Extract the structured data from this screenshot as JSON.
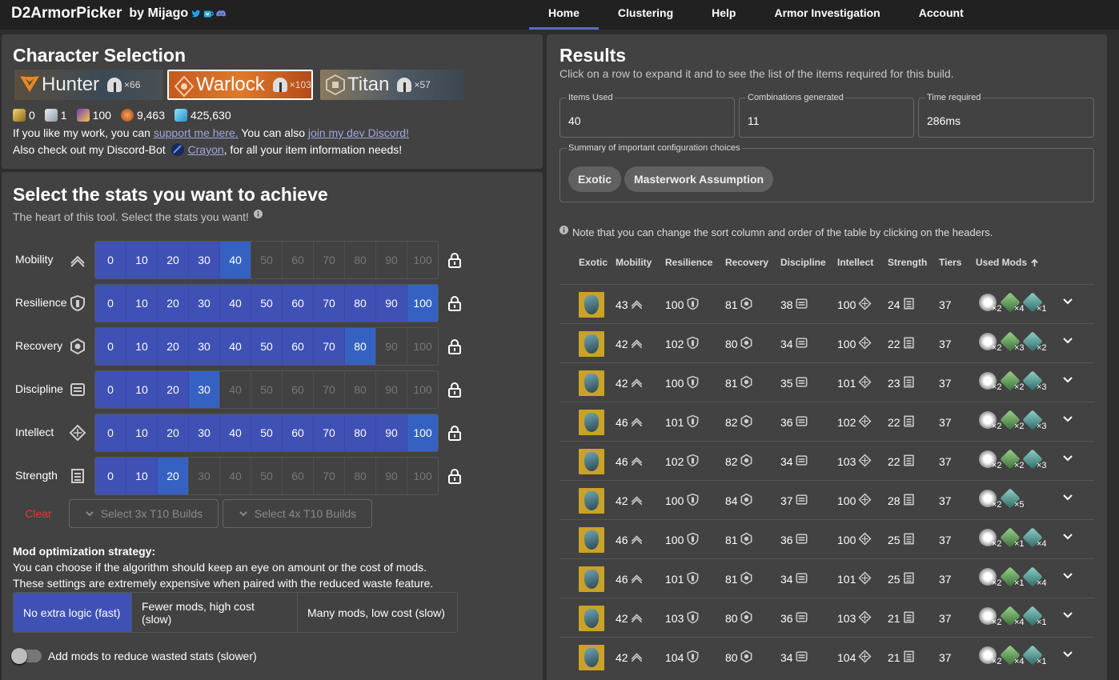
{
  "app": {
    "title": "D2ArmorPicker",
    "by": "by Mijago",
    "social_icons": [
      "twitter-icon",
      "ko-fi-icon",
      "discord-icon"
    ]
  },
  "nav": {
    "items": [
      {
        "label": "Home",
        "active": true
      },
      {
        "label": "Clustering",
        "active": false
      },
      {
        "label": "Help",
        "active": false
      },
      {
        "label": "Armor Investigation",
        "active": false
      },
      {
        "label": "Account",
        "active": false
      }
    ]
  },
  "character": {
    "title": "Character Selection",
    "classes": [
      {
        "name": "Hunter",
        "count": "×66",
        "selected": false
      },
      {
        "name": "Warlock",
        "count": "×103",
        "selected": true
      },
      {
        "name": "Titan",
        "count": "×57",
        "selected": false
      }
    ],
    "currencies": [
      "0",
      "1",
      "100",
      "9,463",
      "425,630"
    ],
    "support_prefix": "If you like my work, you can ",
    "support_link": "support me here.",
    "support_mid": " You can also ",
    "discord_link": "join my dev Discord!",
    "bot_prefix": "Also check out my Discord-Bot ",
    "bot_link": "Crayon",
    "bot_suffix": ", for all your item information needs!"
  },
  "stats": {
    "title": "Select the stats you want to achieve",
    "subtitle": "The heart of this tool. Select the stats you want!",
    "ticks": [
      "0",
      "10",
      "20",
      "30",
      "40",
      "50",
      "60",
      "70",
      "80",
      "90",
      "100"
    ],
    "rows": [
      {
        "name": "Mobility",
        "value": 40
      },
      {
        "name": "Resilience",
        "value": 100
      },
      {
        "name": "Recovery",
        "value": 80
      },
      {
        "name": "Discipline",
        "value": 30
      },
      {
        "name": "Intellect",
        "value": 100
      },
      {
        "name": "Strength",
        "value": 20
      }
    ],
    "clear_label": "Clear",
    "t10_3_label": "Select 3x T10 Builds",
    "t10_4_label": "Select 4x T10 Builds",
    "mod_strategy_title": "Mod optimization strategy:",
    "mod_strategy_line1": "You can choose if the algorithm should keep an eye on amount or the cost of mods.",
    "mod_strategy_line2": "These settings are extremely expensive when paired with the reduced waste feature.",
    "strategy_options": [
      {
        "label": "No extra logic (fast)",
        "active": true
      },
      {
        "label": "Fewer mods, high cost (slow)",
        "active": false
      },
      {
        "label": "Many mods, low cost (slow)",
        "active": false
      }
    ],
    "reduce_waste_label": "Add mods to reduce wasted stats (slower)"
  },
  "results": {
    "title": "Results",
    "subtitle": "Click on a row to expand it and to see the list of the items required for this build.",
    "items_used_label": "Items Used",
    "items_used": "40",
    "combinations_label": "Combinations generated",
    "combinations": "11",
    "time_label": "Time required",
    "time": "286ms",
    "summary_label": "Summary of important configuration choices",
    "chips": [
      "Exotic",
      "Masterwork Assumption"
    ],
    "note": "Note that you can change the sort column and order of the table by clicking on the headers.",
    "headers": [
      "Exotic",
      "Mobility",
      "Resilience",
      "Recovery",
      "Discipline",
      "Intellect",
      "Strength",
      "Tiers",
      "Used Mods"
    ],
    "rows": [
      {
        "mob": "43",
        "res": "100",
        "rec": "81",
        "dis": "38",
        "int": "100",
        "str": "24",
        "tiers": "37",
        "mods": [
          [
            "×2",
            "white"
          ],
          [
            "×4",
            "green"
          ],
          [
            "×1",
            "teal"
          ]
        ]
      },
      {
        "mob": "42",
        "res": "102",
        "rec": "80",
        "dis": "34",
        "int": "100",
        "str": "22",
        "tiers": "37",
        "mods": [
          [
            "×2",
            "white"
          ],
          [
            "×3",
            "green"
          ],
          [
            "×2",
            "teal"
          ]
        ]
      },
      {
        "mob": "42",
        "res": "100",
        "rec": "81",
        "dis": "35",
        "int": "101",
        "str": "23",
        "tiers": "37",
        "mods": [
          [
            "×2",
            "white"
          ],
          [
            "×2",
            "green"
          ],
          [
            "×3",
            "teal"
          ]
        ]
      },
      {
        "mob": "46",
        "res": "101",
        "rec": "82",
        "dis": "36",
        "int": "102",
        "str": "22",
        "tiers": "37",
        "mods": [
          [
            "×2",
            "white"
          ],
          [
            "×2",
            "green"
          ],
          [
            "×3",
            "teal"
          ]
        ]
      },
      {
        "mob": "46",
        "res": "102",
        "rec": "82",
        "dis": "34",
        "int": "103",
        "str": "22",
        "tiers": "37",
        "mods": [
          [
            "×2",
            "white"
          ],
          [
            "×2",
            "green"
          ],
          [
            "×3",
            "teal"
          ]
        ]
      },
      {
        "mob": "42",
        "res": "100",
        "rec": "84",
        "dis": "37",
        "int": "100",
        "str": "28",
        "tiers": "37",
        "mods": [
          [
            "×2",
            "white"
          ],
          [
            "×5",
            "teal"
          ]
        ]
      },
      {
        "mob": "46",
        "res": "100",
        "rec": "81",
        "dis": "36",
        "int": "100",
        "str": "25",
        "tiers": "37",
        "mods": [
          [
            "×2",
            "white"
          ],
          [
            "×1",
            "green"
          ],
          [
            "×4",
            "teal"
          ]
        ]
      },
      {
        "mob": "46",
        "res": "101",
        "rec": "81",
        "dis": "34",
        "int": "101",
        "str": "25",
        "tiers": "37",
        "mods": [
          [
            "×2",
            "white"
          ],
          [
            "×1",
            "green"
          ],
          [
            "×4",
            "teal"
          ]
        ]
      },
      {
        "mob": "42",
        "res": "103",
        "rec": "80",
        "dis": "36",
        "int": "103",
        "str": "21",
        "tiers": "37",
        "mods": [
          [
            "×2",
            "white"
          ],
          [
            "×4",
            "green"
          ],
          [
            "×1",
            "teal"
          ]
        ]
      },
      {
        "mob": "42",
        "res": "104",
        "rec": "80",
        "dis": "34",
        "int": "104",
        "str": "21",
        "tiers": "37",
        "mods": [
          [
            "×2",
            "white"
          ],
          [
            "×4",
            "green"
          ],
          [
            "×1",
            "teal"
          ]
        ]
      }
    ]
  },
  "colors": {
    "accent": "#3f51b5",
    "selected_tick": "#3562c2",
    "clear": "#e53935",
    "exotic_bg": "#c9a227"
  }
}
